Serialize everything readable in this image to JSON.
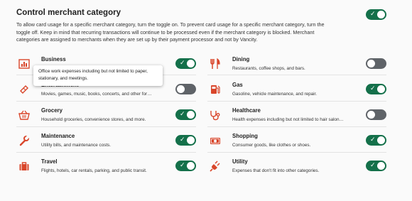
{
  "header": {
    "title": "Control merchant category",
    "description": "To allow card usage for a specific merchant category, turn the toggle on. To prevent card usage for a specific merchant category, turn the toggle off. Keep in mind that recurring transactions will continue to be processed even if the merchant category is blocked. Merchant categories are assigned to merchants when they are set up by their payment processor and not by Vancity.",
    "master_toggle": "on"
  },
  "colors": {
    "accent": "#14704a",
    "icon": "#d9462b",
    "toggle_off": "#5f6368"
  },
  "categories_left": [
    {
      "name": "Business",
      "description": "",
      "icon": "chart-icon",
      "state": "on"
    },
    {
      "name": "Entertainment",
      "description": "Movies, games, music, books, concerts, and other for…",
      "icon": "ticket-icon",
      "state": "off"
    },
    {
      "name": "Grocery",
      "description": "Household groceries, convenience stores, and more.",
      "icon": "basket-icon",
      "state": "on"
    },
    {
      "name": "Maintenance",
      "description": "Utility bills, and maintenance costs.",
      "icon": "wrench-icon",
      "state": "on"
    },
    {
      "name": "Travel",
      "description": "Flights, hotels, car rentals, parking, and public transit.",
      "icon": "suitcase-icon",
      "state": "on"
    }
  ],
  "categories_right": [
    {
      "name": "Dining",
      "description": "Restaurants, coffee shops, and bars.",
      "icon": "utensils-icon",
      "state": "off"
    },
    {
      "name": "Gas",
      "description": "Gasoline, vehicle maintenance, and repair.",
      "icon": "gas-pump-icon",
      "state": "on"
    },
    {
      "name": "Healthcare",
      "description": "Health expenses including but not limited to hair salon…",
      "icon": "stethoscope-icon",
      "state": "off"
    },
    {
      "name": "Shopping",
      "description": "Consumer goods, like clothes or shoes.",
      "icon": "money-icon",
      "state": "on"
    },
    {
      "name": "Utility",
      "description": "Expenses that don't fit into other categories.",
      "icon": "plug-icon",
      "state": "on"
    }
  ],
  "tooltip": {
    "text": "Office work expenses including but not limited to paper, stationary, and meetings."
  }
}
